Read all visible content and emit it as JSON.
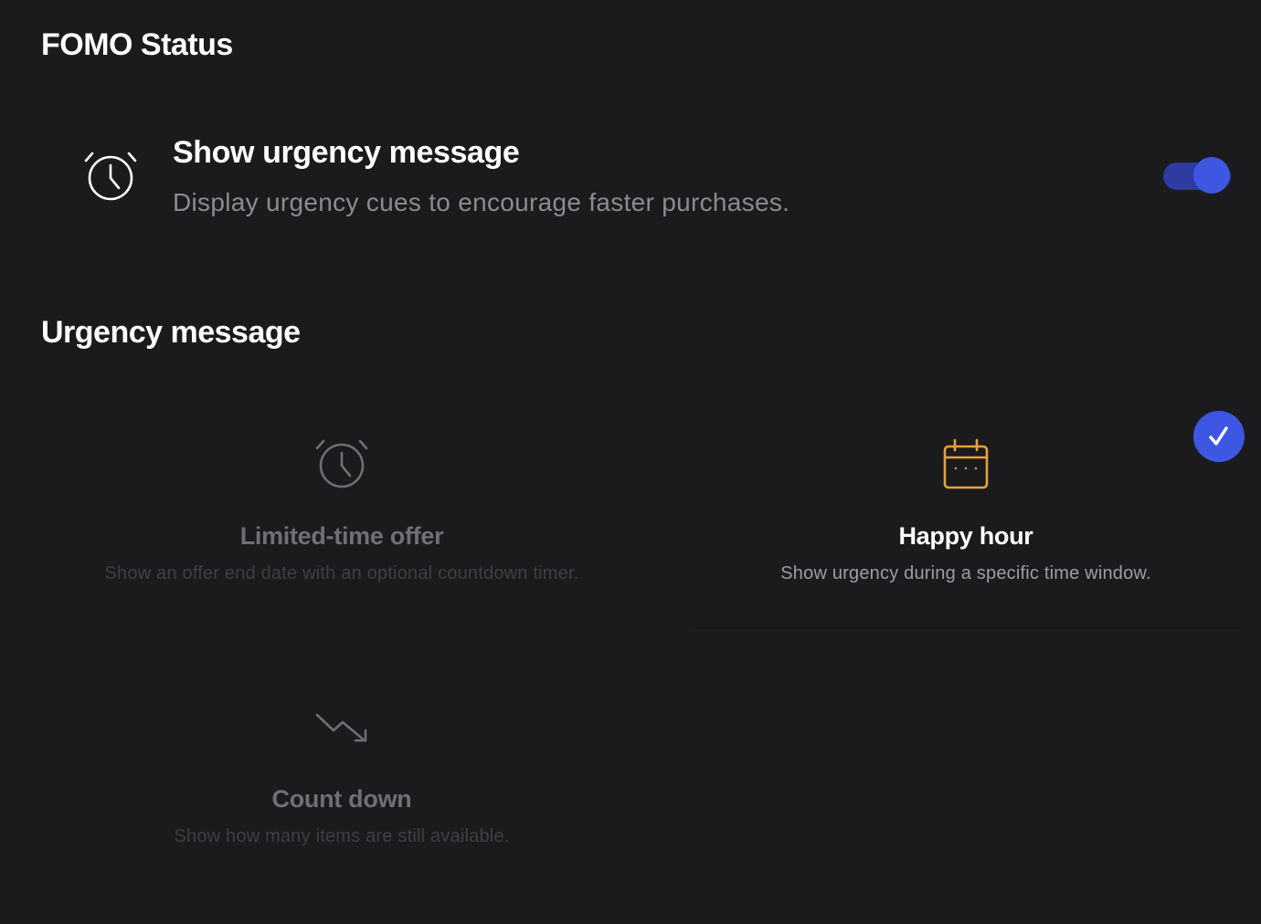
{
  "fomo_status": {
    "title": "FOMO Status",
    "setting": {
      "icon": "alarm-clock-icon",
      "heading": "Show urgency message",
      "description": "Display urgency cues to encourage faster purchases.",
      "enabled": true
    }
  },
  "urgency_message": {
    "title": "Urgency message",
    "options": [
      {
        "icon": "alarm-clock-icon",
        "title": "Limited-time offer",
        "description": "Show an offer end date with an optional countdown timer.",
        "selected": false
      },
      {
        "icon": "calendar-icon",
        "title": "Happy hour",
        "description": "Show urgency during a specific time window.",
        "selected": true
      },
      {
        "icon": "trending-down-icon",
        "title": "Count down",
        "description": "Show how many items are still available.",
        "selected": false
      }
    ]
  },
  "colors": {
    "background": "#1b1b1d",
    "accent": "#3d57e3",
    "toggle_track": "#2e3ba0",
    "calendar_icon": "#e6a23c"
  }
}
